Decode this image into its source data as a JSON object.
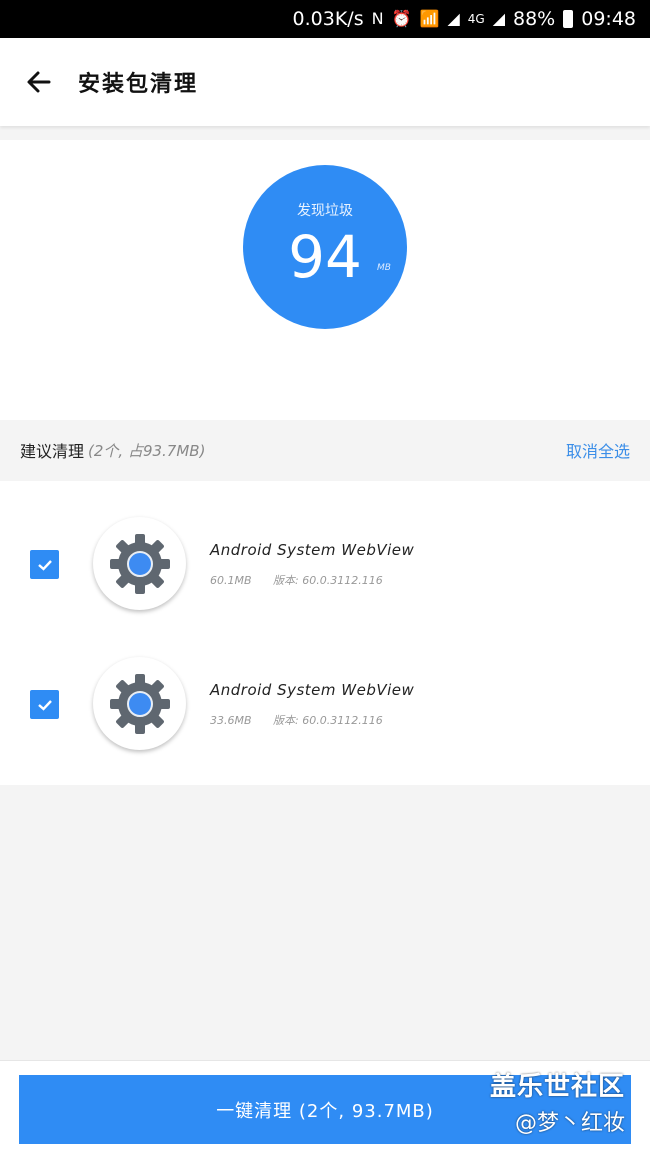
{
  "status_bar": {
    "speed": "0.03K/s",
    "network": "4G",
    "battery": "88%",
    "time": "09:48"
  },
  "app_bar": {
    "title": "安装包清理"
  },
  "summary": {
    "label": "发现垃圾",
    "value": "94",
    "unit": "MB",
    "accent": "#2f8cf4"
  },
  "section": {
    "title": "建议清理",
    "subtitle": "(2个, 占93.7MB)",
    "deselect_all": "取消全选"
  },
  "items": [
    {
      "name": "Android System WebView",
      "size": "60.1MB",
      "version": "版本: 60.0.3112.116",
      "checked": true,
      "icon": "gear-icon"
    },
    {
      "name": "Android System WebView",
      "size": "33.6MB",
      "version": "版本: 60.0.3112.116",
      "checked": true,
      "icon": "gear-icon"
    }
  ],
  "clean_button": {
    "label": "一键清理 (2个, 93.7MB)"
  },
  "watermark": {
    "line1": "盖乐世社区",
    "line2": "@梦丶红妆"
  }
}
